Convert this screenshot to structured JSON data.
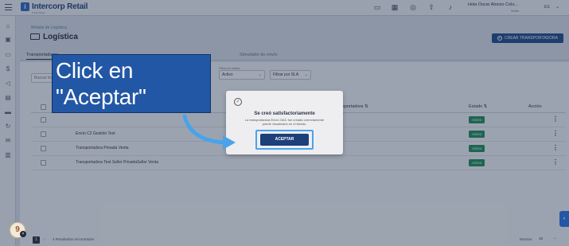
{
  "header": {
    "logo_text": "Intercorp Retail",
    "logo_sub": "Portal Retail",
    "user_name": "Hola  Oscar Alonso Colo...",
    "user_role": "Seller",
    "language": "ES",
    "icons": [
      "book-icon",
      "calendar-icon",
      "headset-icon",
      "upload-icon",
      "bell-icon"
    ]
  },
  "sidebar": {
    "icons": [
      "home-icon",
      "box-icon",
      "folder-icon",
      "dollar-icon",
      "megaphone-icon",
      "clipboard-icon",
      "truck-icon",
      "refresh-icon",
      "mail-icon",
      "store-icon"
    ]
  },
  "page": {
    "breadcrumb": "Módulo de Logística",
    "title": "Logística",
    "create_button": "CREAR TRANSPORTADORA"
  },
  "tabs": [
    {
      "label": "Transportadoras",
      "active": true
    },
    {
      "label": "Simulador de envío",
      "active": false
    }
  ],
  "filters": {
    "search_placeholder": "Buscar tra...",
    "status_label": "Filtrar por estado",
    "status_value": "Activo",
    "sla_placeholder": "Filtrar por SLA"
  },
  "table": {
    "headers": {
      "transportadora": "Transportadora",
      "estado": "Estado",
      "accion": "Acción"
    },
    "rows": [
      {
        "name": "Envío C2 Gestión Test",
        "status": "Activo"
      },
      {
        "name": "Transportadora Privada Venta",
        "status": "Activo"
      },
      {
        "name": "Transportadora Test Seller PrivadaSeller Venta",
        "status": "Activo"
      }
    ],
    "first_row_status": "Activo"
  },
  "footer": {
    "page": "1",
    "results": "4 Resultados encontrados",
    "show_label": "Mostrar",
    "per_page": "10"
  },
  "modal": {
    "title": "Se creó satisfactoriamente",
    "message": "La transportadora Envío OAC fue creada correctamente puede visualizarlo en el listado.",
    "accept_label": "ACEPTAR"
  },
  "callout": {
    "text": "Click en\n\"Aceptar\""
  },
  "help": {
    "avatar_glyph": "9",
    "close_glyph": "×"
  },
  "colors": {
    "primary": "#1f4c8c",
    "callout": "#2257a5",
    "highlight": "#4aa3ea",
    "badge": "#1f8f5a"
  }
}
